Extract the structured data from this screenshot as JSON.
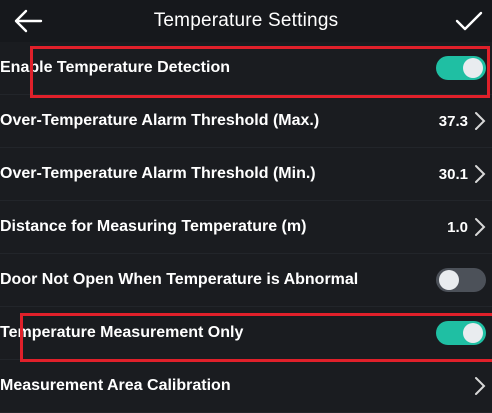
{
  "header": {
    "title": "Temperature Settings",
    "back_icon": "arrow-left-icon",
    "confirm_icon": "checkmark-icon"
  },
  "settings": [
    {
      "label": "Enable Temperature Detection",
      "type": "toggle",
      "on": true
    },
    {
      "label": "Over-Temperature Alarm Threshold (Max.)",
      "type": "value",
      "value": "37.3"
    },
    {
      "label": "Over-Temperature Alarm Threshold (Min.)",
      "type": "value",
      "value": "30.1"
    },
    {
      "label": "Distance for Measuring Temperature (m)",
      "type": "value",
      "value": "1.0"
    },
    {
      "label": "Door Not Open When Temperature is Abnormal",
      "type": "toggle",
      "on": false
    },
    {
      "label": "Temperature Measurement Only",
      "type": "toggle",
      "on": true
    },
    {
      "label": "Measurement Area Calibration",
      "type": "link",
      "value": ""
    }
  ],
  "colors": {
    "toggle_on": "#1fbfa3",
    "toggle_off": "#4c5159",
    "highlight": "#e0202a",
    "background": "#1a1c20"
  }
}
